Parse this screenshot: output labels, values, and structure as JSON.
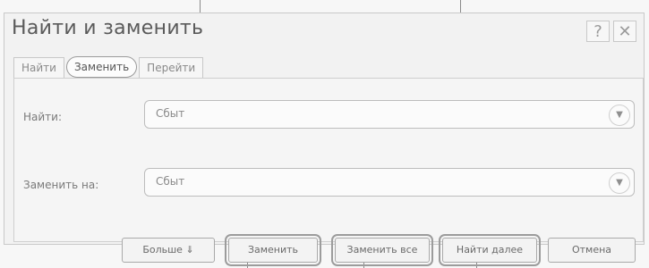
{
  "dialog": {
    "title": "Найти и заменить",
    "help_label": "?",
    "close_label": "✕"
  },
  "tabs": [
    {
      "label": "Найти"
    },
    {
      "label": "Заменить"
    },
    {
      "label": "Перейти"
    }
  ],
  "find": {
    "label": "Найти:",
    "value": "Сбыт"
  },
  "replace": {
    "label": "Заменить на:",
    "value": "Сбыт"
  },
  "buttons": {
    "more": "Больше ⇓",
    "replace": "Заменить",
    "replace_all": "Заменить все",
    "find_next": "Найти далее",
    "cancel": "Отмена"
  },
  "icons": {
    "dropdown": "chevron-down-icon"
  }
}
